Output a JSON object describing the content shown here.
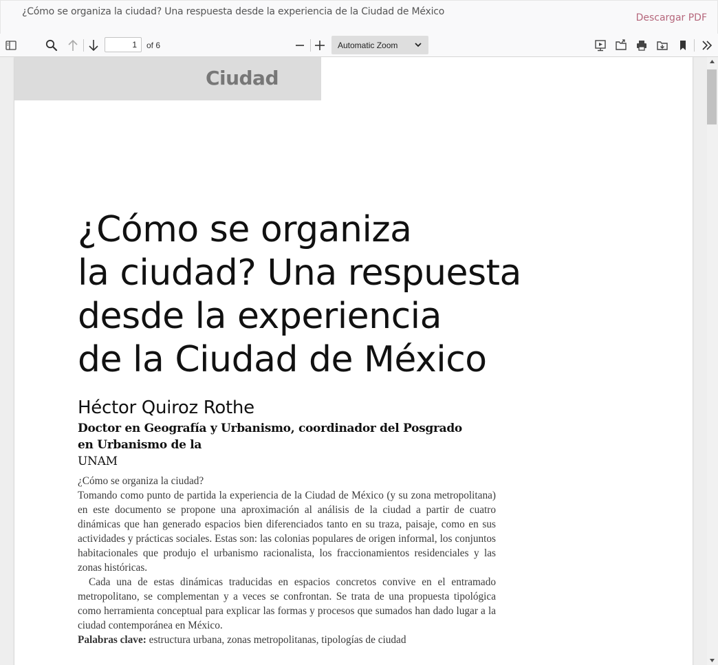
{
  "header": {
    "doc_title": "¿Cómo se organiza la ciudad? Una respuesta desde la experiencia de la Ciudad de México",
    "download_label": "Descargar PDF"
  },
  "toolbar": {
    "page_number": "1",
    "page_count": "of 6",
    "zoom": "Automatic Zoom",
    "icons": [
      "sidebar-toggle-icon",
      "search-icon",
      "arrow-up-icon",
      "arrow-down-icon",
      "zoom-out-icon",
      "zoom-in-icon",
      "presentation-icon",
      "open-file-icon",
      "print-icon",
      "download-icon",
      "bookmark-icon",
      "double-chevron-right-icon"
    ]
  },
  "page": {
    "section_label": "Ciudad",
    "title_lines": [
      "¿Cómo se organiza",
      "la ciudad? Una respuesta",
      "desde la experiencia",
      "de la Ciudad de México"
    ],
    "author": "Héctor Quiroz Rothe",
    "affiliation_line1": "Doctor en Geografía y Urbanismo, coordinador del Posgrado",
    "affiliation_line2_prefix": "en Urbanismo de la ",
    "affiliation_line2_abbr": "UNAM",
    "abstract_question": "¿Cómo se organiza la ciudad?",
    "abstract_p1": "Tomando como punto de partida la experiencia de la Ciudad de México (y su zona metropolitana) en este documento se propone una aproximación al análisis de la ciudad a partir de cuatro dinámicas que han generado espacios bien diferenciados tanto en su traza, paisaje, como en sus actividades y prácticas sociales. Estas son: las colonias populares de origen informal, los conjuntos habitacionales que produjo el urbanismo racionalista, los fraccionamientos residenciales y las zonas históricas.",
    "abstract_p2": "Cada una de estas dinámicas traducidas en espacios concretos convive en el entramado metropolitano, se complementan y a veces se confrontan. Se trata de una propuesta tipológica como herramienta conceptual para explicar las formas y procesos que sumados han dado lugar a la ciudad contemporánea en México.",
    "keywords_label": "Palabras clave:",
    "keywords": " estructura urbana, zonas metropolitanas, tipologías de ciudad"
  },
  "colors": {
    "accent_link": "#b5667b",
    "band": "#dcdcdc",
    "toolbar_bg": "#f9f9fa"
  }
}
